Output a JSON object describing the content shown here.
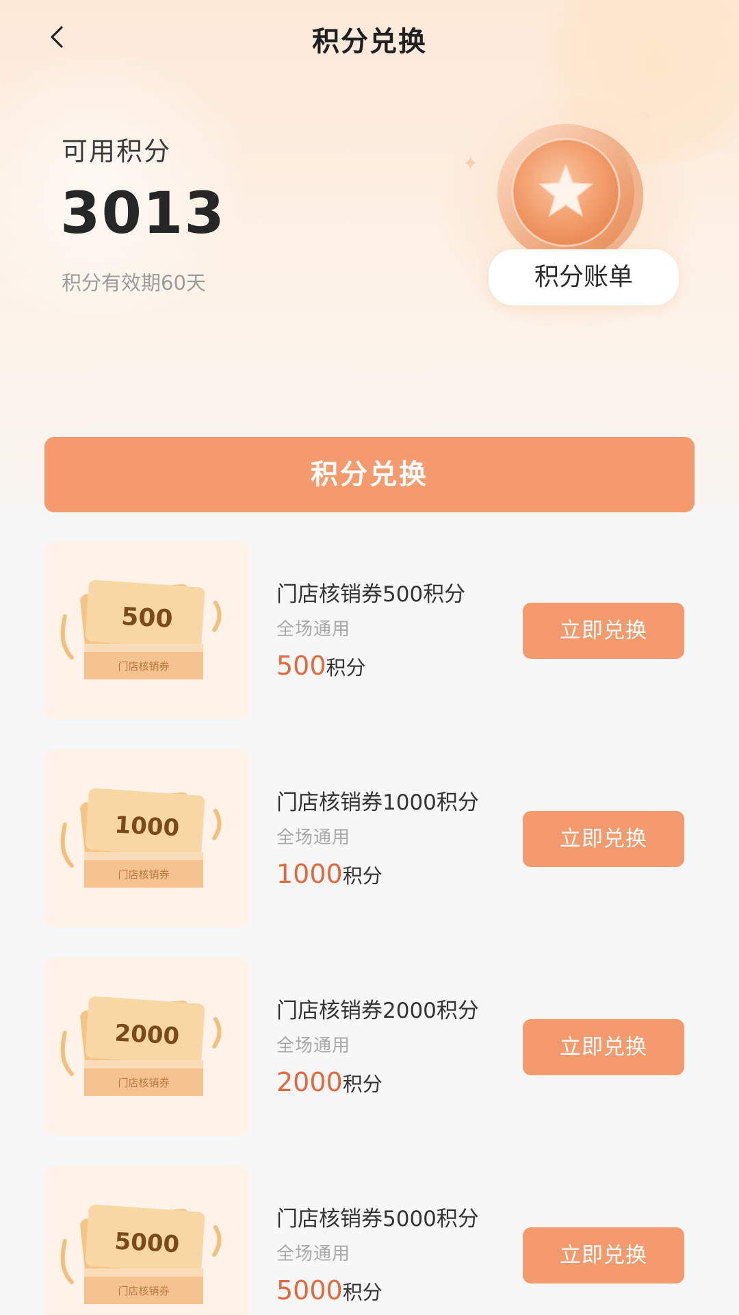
{
  "nav": {
    "title": "积分兑换",
    "back_icon": "chevron-left-icon"
  },
  "points": {
    "label": "可用积分",
    "value": "3013",
    "expire_note": "积分有效期60天",
    "bill_button": "积分账单",
    "coin_icon": "star-coin-icon"
  },
  "banner": {
    "label": "积分兑换"
  },
  "colors": {
    "accent": "#f59a6c",
    "price": "#e3683c",
    "coin": "#f3a06f"
  },
  "items": [
    {
      "badge": "500",
      "ticket_label": "门店核销券",
      "title": "门店核销券500积分",
      "subtitle": "全场通用",
      "price_num": "500",
      "price_unit": "积分",
      "button": "立即兑换"
    },
    {
      "badge": "1000",
      "ticket_label": "门店核销券",
      "title": "门店核销券1000积分",
      "subtitle": "全场通用",
      "price_num": "1000",
      "price_unit": "积分",
      "button": "立即兑换"
    },
    {
      "badge": "2000",
      "ticket_label": "门店核销券",
      "title": "门店核销券2000积分",
      "subtitle": "全场通用",
      "price_num": "2000",
      "price_unit": "积分",
      "button": "立即兑换"
    },
    {
      "badge": "5000",
      "ticket_label": "门店核销券",
      "title": "门店核销券5000积分",
      "subtitle": "全场通用",
      "price_num": "5000",
      "price_unit": "积分",
      "button": "立即兑换"
    }
  ]
}
